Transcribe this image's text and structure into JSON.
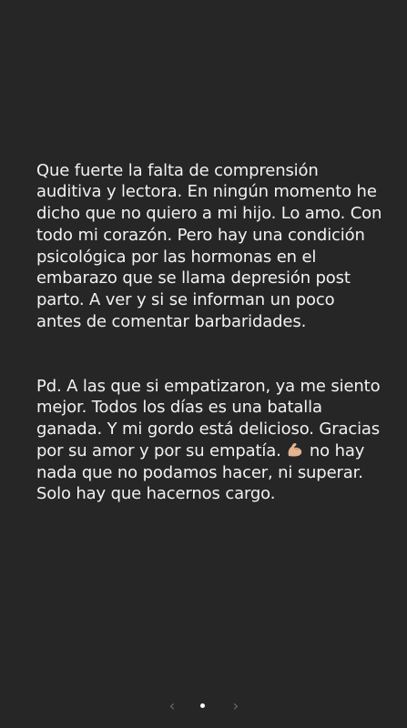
{
  "story": {
    "paragraph_1": "Que fuerte la falta de comprensión auditiva y lectora. En ningún momento he dicho que no quiero a mi hijo. Lo amo. Con todo mi corazón. Pero hay una condición psicológica por las hormonas en el embarazo que se llama depresión post parto. A ver y si se informan un poco antes de comentar barbaridades.",
    "paragraph_2_before_emoji": "Pd. A las que si empatizaron, ya me siento mejor. Todos los días es una batalla ganada. Y mi gordo está delicioso. Gracias por su amor y por su empatía. ",
    "emoji": "flexed-biceps-icon",
    "paragraph_2_after_emoji": " no hay nada que no podamos hacer, ni superar. Solo hay que hacernos cargo."
  },
  "navigation": {
    "prev_icon": "chevron-left-icon",
    "next_icon": "chevron-right-icon",
    "prev_glyph": "‹",
    "next_glyph": "›",
    "current_page": 1,
    "total_pages": 1
  },
  "colors": {
    "background": "#262626",
    "text": "#f2f2f2",
    "nav": "#6f6f6f",
    "dot": "#ffffff"
  }
}
